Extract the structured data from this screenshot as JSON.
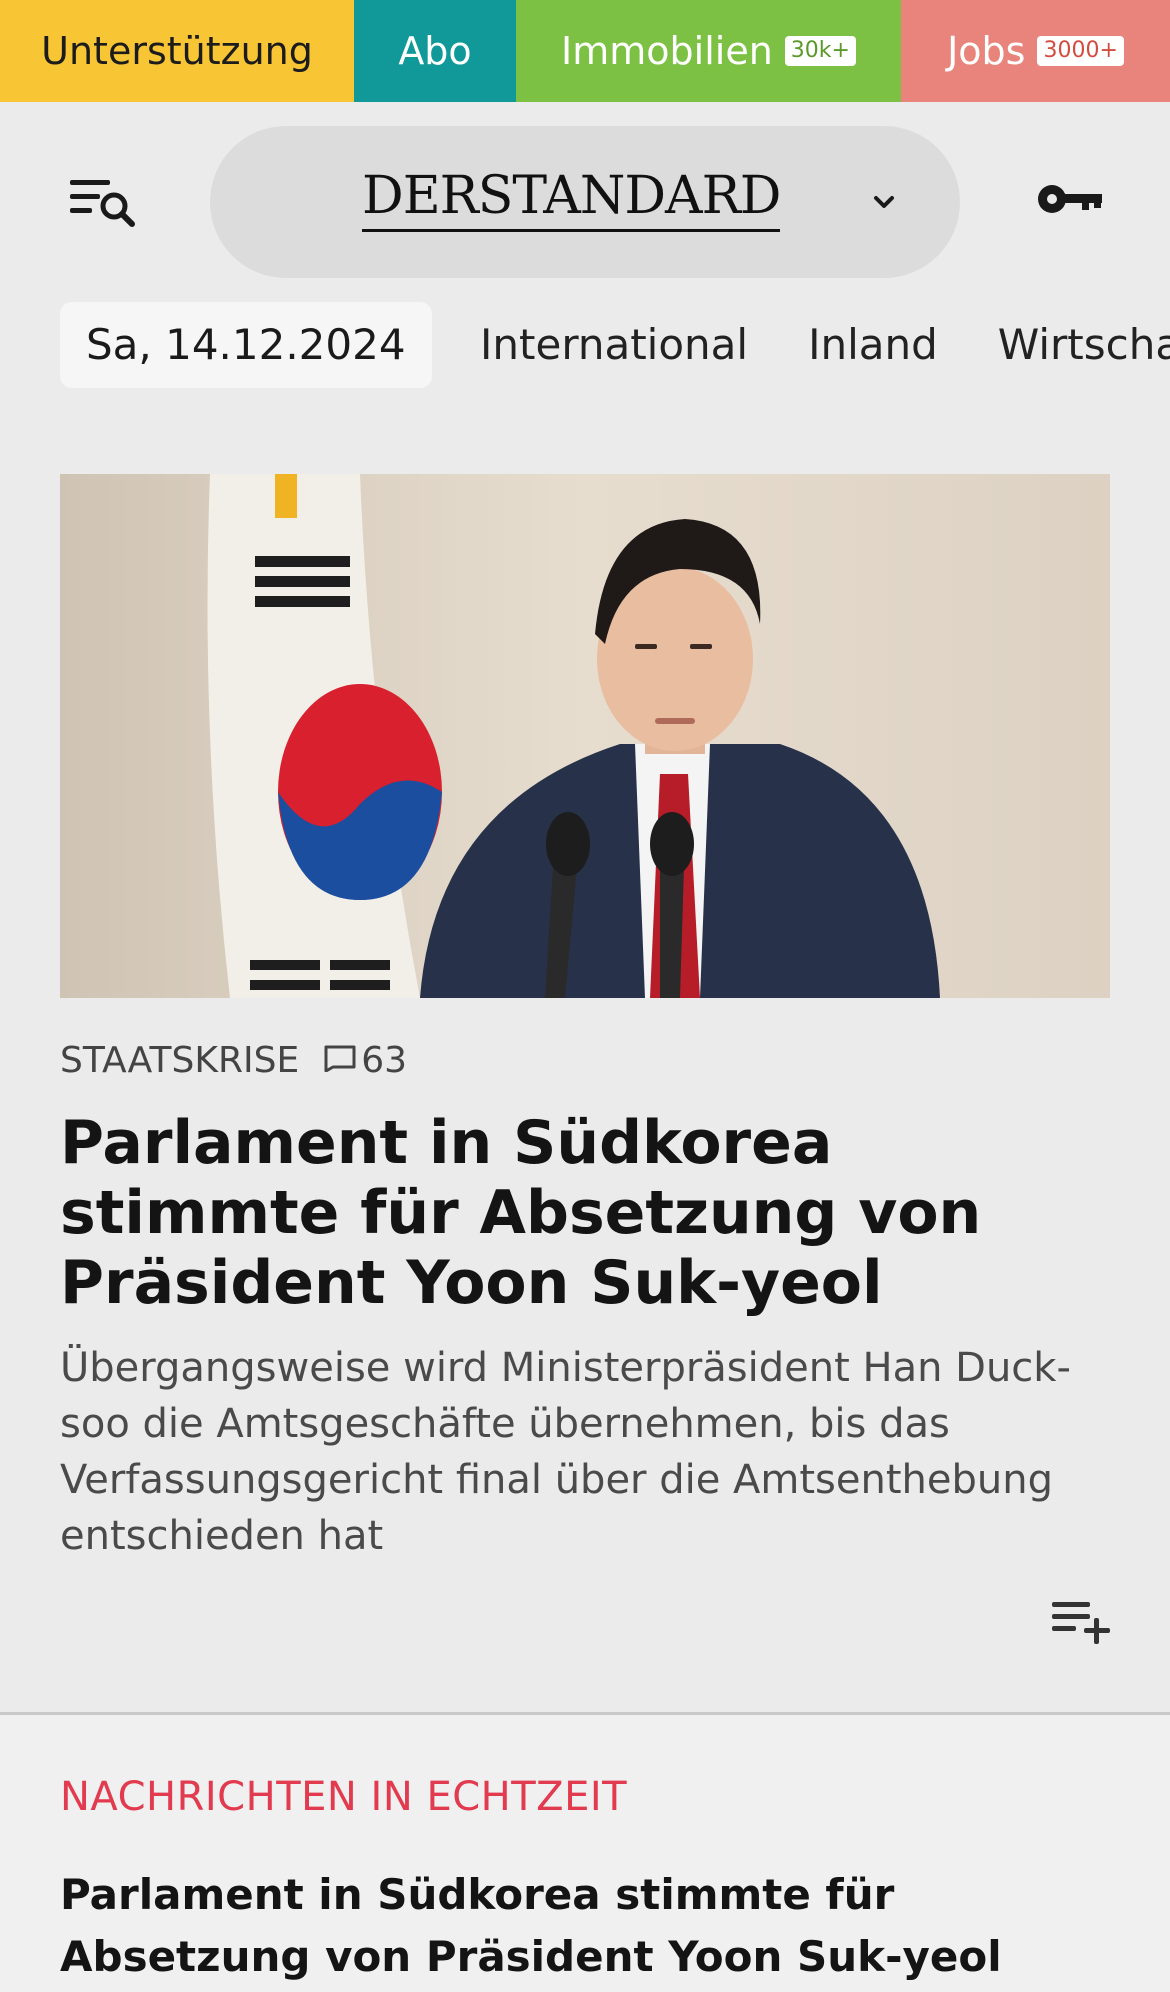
{
  "topbar": {
    "support_label": "Unterstützung",
    "abo_label": "Abo",
    "immo_label": "Immobilien",
    "immo_badge": "30k+",
    "jobs_label": "Jobs",
    "jobs_badge": "3000+",
    "colors": {
      "support": "#f8c535",
      "abo": "#11999a",
      "immo": "#7cc143",
      "jobs": "#e8847b"
    }
  },
  "header": {
    "brand_name": "DERSTANDARD",
    "menu_icon": "menu-search-icon",
    "dropdown_icon": "chevron-down-icon",
    "login_icon": "key-icon"
  },
  "nav": {
    "date": "Sa, 14.12.2024",
    "links": [
      "International",
      "Inland",
      "Wirtscha"
    ]
  },
  "hero": {
    "kicker": "STAATSKRISE",
    "comment_icon": "comment-icon",
    "comment_count": "63",
    "headline": "Parlament in Südkorea stimmte für Absetzung von Präsident Yoon Suk-yeol",
    "lead": "Übergangsweise wird Ministerpräsident Han Duck-soo die Amtsgeschäfte übernehmen, bis das Verfassungsgericht final über die Amtsenthebung entschieden hat",
    "playlist_icon": "playlist-add-icon"
  },
  "live": {
    "kicker": "NACHRICHTEN IN ECHTZEIT",
    "kicker_color": "#e23a4e",
    "headline": "Parlament in Südkorea stimmte für Absetzung von Präsident Yoon Suk-yeol"
  }
}
